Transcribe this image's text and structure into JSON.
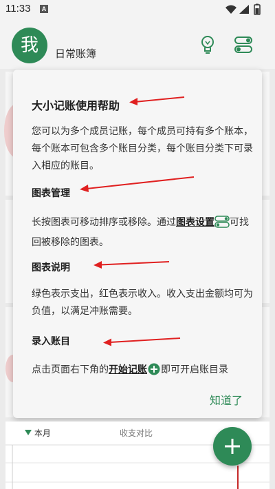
{
  "status_bar": {
    "time": "11:33",
    "notification_icon": "A"
  },
  "header": {
    "avatar_text": "我",
    "book_title": "日常账簿",
    "bulb_icon": "lightbulb-icon",
    "toggle_icon": "toggle-icon"
  },
  "dialog": {
    "title": "大小记账使用帮助",
    "intro": "您可以为多个成员记账，每个成员可持有多个账本，每个账本可包含多个账目分类，每个账目分类下可录入相应的账目。",
    "sec1_title": "图表管理",
    "sec1_pre": "长按图表可移动排序或移除。通过",
    "sec1_link": "图表设置",
    "sec1_post": "可找回被移除的图表。",
    "sec2_title": "图表说明",
    "sec2_body": "绿色表示支出，红色表示收入。收入支出金额均可为负值，以满足冲账需要。",
    "sec3_title": "录入账目",
    "sec3_pre": "点击页面右下角的",
    "sec3_link": "开始记账",
    "sec3_post": "即可开启账目录",
    "ok_label": "知道了"
  },
  "bottom": {
    "month_label": "本月",
    "compare_label": "收支对比"
  },
  "colors": {
    "accent": "#2e8a57",
    "arrow": "#e02020"
  }
}
